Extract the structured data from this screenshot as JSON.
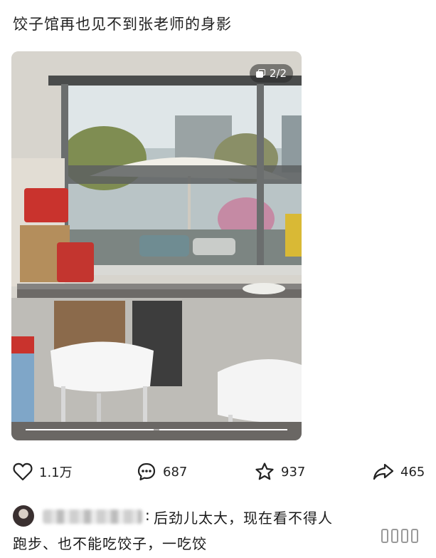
{
  "post": {
    "title": "饺子馆再也见不到张老师的身影",
    "page_indicator": "2/2",
    "carousel": {
      "total": 2,
      "current": 2
    }
  },
  "actions": {
    "like_count": "1.1万",
    "comment_count": "687",
    "favorite_count": "937",
    "share_count": "465"
  },
  "comment": {
    "line1": "后劲儿太大，现在看不得人",
    "line2": "跑步、也不能吃饺子，一吃饺"
  },
  "colors": {
    "text": "#1a1a1a",
    "badge_bg": "#555555"
  },
  "icons": {
    "like": "heart-icon",
    "comment": "chat-bubble-icon",
    "favorite": "star-icon",
    "share": "share-arrow-icon",
    "pages": "image-stack-icon"
  }
}
